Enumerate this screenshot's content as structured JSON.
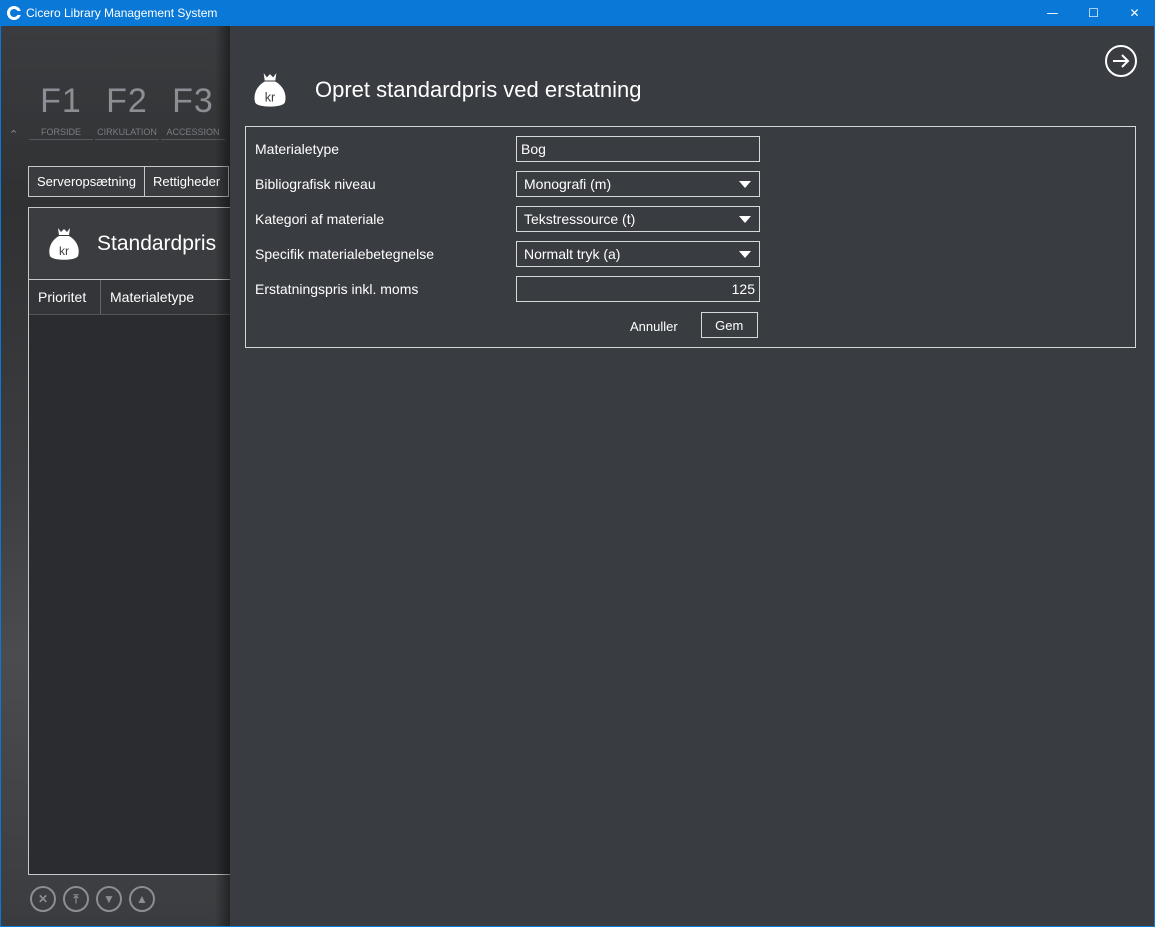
{
  "window": {
    "title": "Cicero Library Management System",
    "minimize": "—",
    "maximize": "☐",
    "close": "✕"
  },
  "background": {
    "fkeys": [
      {
        "key": "F1",
        "label": "FORSIDE"
      },
      {
        "key": "F2",
        "label": "CIRKULATION"
      },
      {
        "key": "F3",
        "label": "ACCESSION"
      }
    ],
    "tabs": [
      "Serveropsætning",
      "Rettigheder"
    ],
    "panel_title": "Standardpris",
    "columns": [
      "Prioritet",
      "Materialetype"
    ],
    "icon_label": "kr"
  },
  "dialog": {
    "title": "Opret standardpris ved erstatning",
    "icon_label": "kr",
    "fields": [
      {
        "label": "Materialetype",
        "value": "Bog",
        "type": "text"
      },
      {
        "label": "Bibliografisk niveau",
        "value": "Monografi (m)",
        "type": "select"
      },
      {
        "label": "Kategori af materiale",
        "value": "Tekstressource (t)",
        "type": "select"
      },
      {
        "label": "Specifik materialebetegnelse",
        "value": "Normalt tryk (a)",
        "type": "select"
      },
      {
        "label": "Erstatningspris inkl. moms",
        "value": "125",
        "type": "number"
      }
    ],
    "cancel_label": "Annuller",
    "save_label": "Gem"
  }
}
